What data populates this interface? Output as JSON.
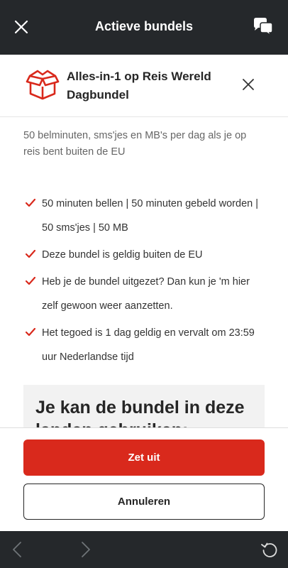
{
  "topbar": {
    "title": "Actieve bundels",
    "icons": {
      "close": "close-icon",
      "chat": "chat-icon"
    }
  },
  "sheet": {
    "title": "Alles-in-1 op Reis Wereld Dagbundel",
    "icon": "package-box-icon",
    "description": "50 belminuten, sms'jes en MB's per dag als je op reis bent buiten de EU",
    "features": [
      "50 minuten bellen | 50 minuten gebeld worden | 50 sms'jes | 50 MB",
      "Deze bundel is geldig buiten de EU",
      "Heb je de bundel uitgezet? Dan kun je 'm hier zelf gewoon weer aanzetten.",
      "Het tegoed is 1 dag geldig en vervalt om 23:59 uur Nederlandse tijd"
    ],
    "countries_title": "Je kan de bundel in deze landen gebruiken:"
  },
  "actions": {
    "primary_label": "Zet uit",
    "secondary_label": "Annuleren"
  },
  "bottombar": {
    "icons": [
      "back-arrow-icon",
      "forward-arrow-icon",
      "refresh-icon"
    ]
  },
  "colors": {
    "brand_red": "#d9291c",
    "dark_bar": "#25282b"
  }
}
